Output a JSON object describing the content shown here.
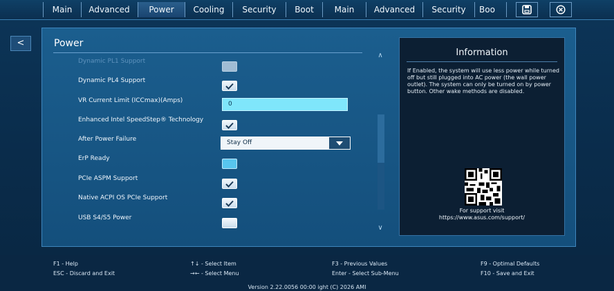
{
  "tabs": [
    "Main",
    "Advanced",
    "Power",
    "Cooling",
    "Security",
    "Boot",
    "Main",
    "Advanced",
    "Security",
    "Boo"
  ],
  "active_tab": "Power",
  "toolbar": {
    "back_label": "<"
  },
  "panel": {
    "title": "Power"
  },
  "settings": [
    {
      "label": "Dynamic PL1 Support",
      "control": "checkbox",
      "checked": false
    },
    {
      "label": "Dynamic PL4 Support",
      "control": "checkbox",
      "checked": true
    },
    {
      "label": "VR Current Limit (ICCmax)(Amps)",
      "control": "text",
      "value": "0"
    },
    {
      "label": "Enhanced Intel SpeedStep® Technology",
      "control": "checkbox",
      "checked": true
    },
    {
      "label": "After Power Failure",
      "control": "dropdown",
      "value": "Stay Off"
    },
    {
      "label": "ErP Ready",
      "control": "checkbox",
      "checked": false
    },
    {
      "label": "PCIe ASPM Support",
      "control": "checkbox",
      "checked": true
    },
    {
      "label": "Native ACPI OS PCIe Support",
      "control": "checkbox",
      "checked": true
    },
    {
      "label": "USB S4/S5 Power",
      "control": "checkbox",
      "checked": false
    }
  ],
  "info": {
    "title": "Information",
    "body": "If Enabled, the system will use less power while turned off but still plugged into AC power (the wall power outlet). The system can only be turned on by power button. Other wake methods are disabled.",
    "support_line1": "For support visit",
    "support_line2": "https://www.asus.com/support/"
  },
  "help": {
    "f1": "F1 - Help",
    "esc": "ESC - Discard and Exit",
    "select_item": "↑↓ - Select Item",
    "select_menu": "→← - Select Menu",
    "f3": "F3 - Previous Values",
    "enter": "Enter - Select Sub-Menu",
    "f9": "F9 - Optimal Defaults",
    "f10": "F10 - Save and Exit"
  },
  "version": "Version 2.22.0056 00:00 ight (C) 2026 AMI",
  "colors": {
    "accent": "#7fe6fb",
    "panel": "#1b5e8e",
    "info_bg": "#0c1f33"
  }
}
